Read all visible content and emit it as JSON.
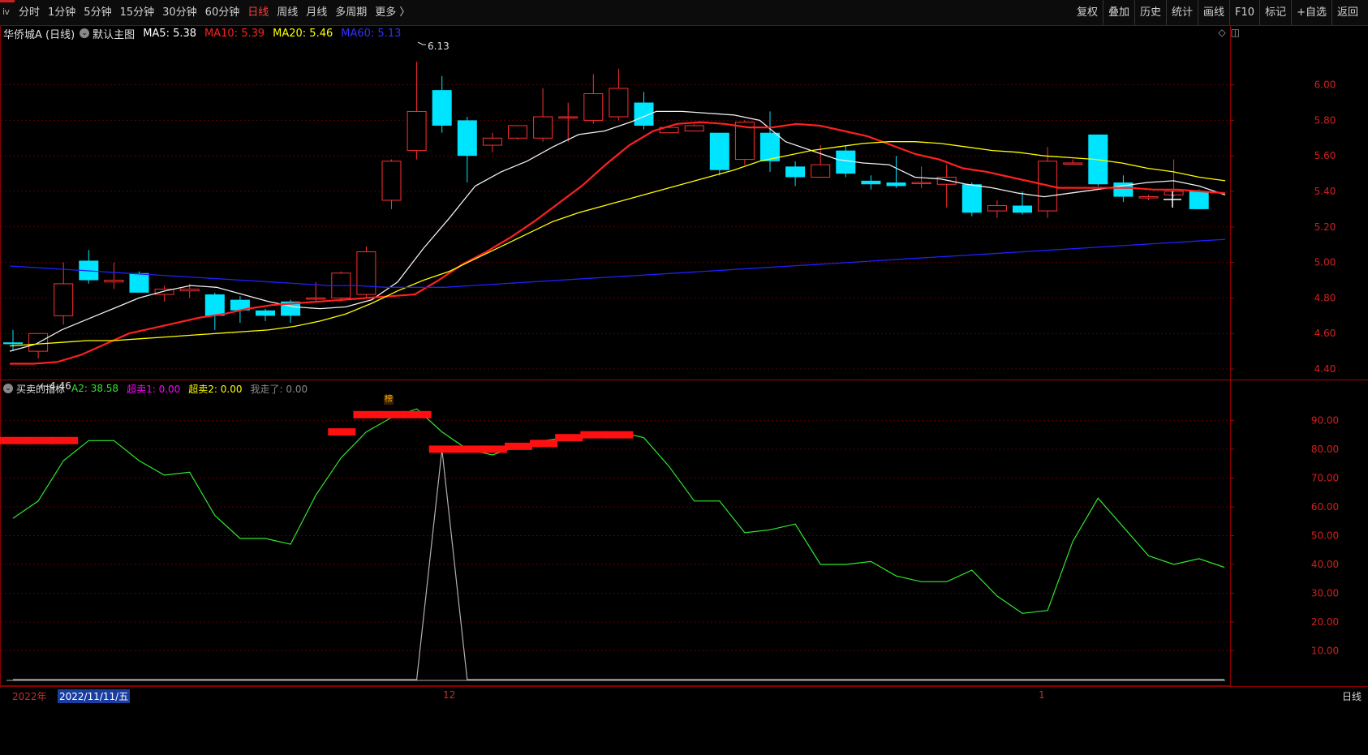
{
  "topbar": {
    "sys_icon": "ⅳ",
    "periods": [
      "分时",
      "1分钟",
      "5分钟",
      "15分钟",
      "30分钟",
      "60分钟",
      "日线",
      "周线",
      "月线",
      "多周期",
      "更多 〉"
    ],
    "active_period": "日线",
    "tools": [
      "复权",
      "叠加",
      "历史",
      "统计",
      "画线",
      "F10",
      "标记",
      "+自选",
      "返回"
    ]
  },
  "main_panel": {
    "stock_name": "华侨城A (日线)",
    "template": "默认主图",
    "ma": [
      {
        "label": "MA5: 5.38",
        "color": "#ffffff"
      },
      {
        "label": "MA10: 5.39",
        "color": "#ff2020"
      },
      {
        "label": "MA20: 5.46",
        "color": "#ffff00"
      },
      {
        "label": "MA60: 5.13",
        "color": "#2020ff"
      }
    ],
    "high_label": "6.13",
    "low_label": "4.46",
    "bang_tag": "榜",
    "icons": [
      "diamond-icon",
      "window-icon"
    ]
  },
  "indicator_panel": {
    "name": "买卖的指标",
    "values": [
      {
        "label": "A2: 38.58",
        "color": "#2ee82e"
      },
      {
        "label": "超卖1: 0.00",
        "color": "#ff00ff"
      },
      {
        "label": "超卖2: 0.00",
        "color": "#ffff00"
      },
      {
        "label": "我走了: 0.00",
        "color": "#888888"
      }
    ]
  },
  "date_axis": {
    "year": "2022年",
    "cursor_date": "2022/11/11/五",
    "month_12": "12",
    "month_1": "1",
    "period_tag": "日线"
  },
  "chart_data": [
    {
      "type": "candlestick",
      "title": "华侨城A (日线)",
      "yticks": [
        "6.00",
        "5.80",
        "5.60",
        "5.40",
        "5.20",
        "5.00",
        "4.80",
        "4.60",
        "4.40"
      ],
      "ylim": [
        4.35,
        6.24
      ],
      "candles": [
        {
          "o": 4.55,
          "h": 4.62,
          "l": 4.5,
          "c": 4.54
        },
        {
          "o": 4.5,
          "h": 4.6,
          "l": 4.46,
          "c": 4.6
        },
        {
          "o": 4.7,
          "h": 5.0,
          "l": 4.65,
          "c": 4.88
        },
        {
          "o": 5.01,
          "h": 5.07,
          "l": 4.88,
          "c": 4.9
        },
        {
          "o": 4.89,
          "h": 5.0,
          "l": 4.85,
          "c": 4.9
        },
        {
          "o": 4.94,
          "h": 4.95,
          "l": 4.83,
          "c": 4.83
        },
        {
          "o": 4.82,
          "h": 4.87,
          "l": 4.78,
          "c": 4.85
        },
        {
          "o": 4.84,
          "h": 4.88,
          "l": 4.8,
          "c": 4.85
        },
        {
          "o": 4.82,
          "h": 4.83,
          "l": 4.62,
          "c": 4.7
        },
        {
          "o": 4.79,
          "h": 4.81,
          "l": 4.66,
          "c": 4.73
        },
        {
          "o": 4.73,
          "h": 4.74,
          "l": 4.67,
          "c": 4.7
        },
        {
          "o": 4.78,
          "h": 4.79,
          "l": 4.66,
          "c": 4.7
        },
        {
          "o": 4.8,
          "h": 4.89,
          "l": 4.78,
          "c": 4.8
        },
        {
          "o": 4.8,
          "h": 4.95,
          "l": 4.78,
          "c": 4.94
        },
        {
          "o": 4.82,
          "h": 5.09,
          "l": 4.8,
          "c": 5.06
        },
        {
          "o": 5.35,
          "h": 5.58,
          "l": 5.3,
          "c": 5.57
        },
        {
          "o": 5.63,
          "h": 6.13,
          "l": 5.58,
          "c": 5.85
        },
        {
          "o": 5.97,
          "h": 6.05,
          "l": 5.73,
          "c": 5.77
        },
        {
          "o": 5.8,
          "h": 5.82,
          "l": 5.45,
          "c": 5.6
        },
        {
          "o": 5.66,
          "h": 5.73,
          "l": 5.62,
          "c": 5.7
        },
        {
          "o": 5.7,
          "h": 5.77,
          "l": 5.69,
          "c": 5.77
        },
        {
          "o": 5.7,
          "h": 5.98,
          "l": 5.68,
          "c": 5.82
        },
        {
          "o": 5.82,
          "h": 5.9,
          "l": 5.68,
          "c": 5.82
        },
        {
          "o": 5.8,
          "h": 6.06,
          "l": 5.78,
          "c": 5.95
        },
        {
          "o": 5.82,
          "h": 6.09,
          "l": 5.8,
          "c": 5.98
        },
        {
          "o": 5.9,
          "h": 5.96,
          "l": 5.75,
          "c": 5.77
        },
        {
          "o": 5.73,
          "h": 5.76,
          "l": 5.73,
          "c": 5.76
        },
        {
          "o": 5.74,
          "h": 5.78,
          "l": 5.74,
          "c": 5.77
        },
        {
          "o": 5.73,
          "h": 5.73,
          "l": 5.49,
          "c": 5.52
        },
        {
          "o": 5.58,
          "h": 5.8,
          "l": 5.55,
          "c": 5.79
        },
        {
          "o": 5.73,
          "h": 5.85,
          "l": 5.51,
          "c": 5.57
        },
        {
          "o": 5.54,
          "h": 5.57,
          "l": 5.43,
          "c": 5.48
        },
        {
          "o": 5.48,
          "h": 5.66,
          "l": 5.48,
          "c": 5.55
        },
        {
          "o": 5.63,
          "h": 5.66,
          "l": 5.48,
          "c": 5.5
        },
        {
          "o": 5.46,
          "h": 5.49,
          "l": 5.41,
          "c": 5.44
        },
        {
          "o": 5.45,
          "h": 5.6,
          "l": 5.42,
          "c": 5.43
        },
        {
          "o": 5.45,
          "h": 5.54,
          "l": 5.42,
          "c": 5.45
        },
        {
          "o": 5.44,
          "h": 5.55,
          "l": 5.31,
          "c": 5.48
        },
        {
          "o": 5.44,
          "h": 5.45,
          "l": 5.26,
          "c": 5.28
        },
        {
          "o": 5.29,
          "h": 5.35,
          "l": 5.25,
          "c": 5.32
        },
        {
          "o": 5.32,
          "h": 5.4,
          "l": 5.27,
          "c": 5.28
        },
        {
          "o": 5.29,
          "h": 5.65,
          "l": 5.25,
          "c": 5.57
        },
        {
          "o": 5.56,
          "h": 5.58,
          "l": 5.55,
          "c": 5.56
        },
        {
          "o": 5.72,
          "h": 5.72,
          "l": 5.43,
          "c": 5.44
        },
        {
          "o": 5.45,
          "h": 5.49,
          "l": 5.34,
          "c": 5.37
        },
        {
          "o": 5.37,
          "h": 5.38,
          "l": 5.35,
          "c": 5.37
        },
        {
          "o": 5.38,
          "h": 5.58,
          "l": 5.37,
          "c": 5.4
        },
        {
          "o": 5.4,
          "h": 5.41,
          "l": 5.3,
          "c": 5.3
        }
      ],
      "series": [
        {
          "name": "MA5",
          "color": "#f0f0f0",
          "values": [
            4.5,
            4.54,
            4.62,
            4.68,
            4.74,
            4.8,
            4.84,
            4.87,
            4.86,
            4.82,
            4.78,
            4.75,
            4.74,
            4.75,
            4.79,
            4.89,
            5.08,
            5.25,
            5.43,
            5.51,
            5.57,
            5.65,
            5.72,
            5.74,
            5.79,
            5.85,
            5.85,
            5.84,
            5.83,
            5.8,
            5.68,
            5.63,
            5.58,
            5.56,
            5.55,
            5.48,
            5.47,
            5.44,
            5.42,
            5.39,
            5.37,
            5.39,
            5.41,
            5.43,
            5.45,
            5.46,
            5.43,
            5.38
          ]
        },
        {
          "name": "MA10",
          "color": "#ff2020",
          "values": [
            4.43,
            4.43,
            4.44,
            4.48,
            4.54,
            4.6,
            4.63,
            4.66,
            4.69,
            4.71,
            4.74,
            4.76,
            4.77,
            4.78,
            4.79,
            4.8,
            4.81,
            4.82,
            4.9,
            4.99,
            5.06,
            5.14,
            5.23,
            5.33,
            5.43,
            5.55,
            5.66,
            5.74,
            5.78,
            5.79,
            5.78,
            5.76,
            5.76,
            5.78,
            5.77,
            5.74,
            5.71,
            5.66,
            5.61,
            5.58,
            5.53,
            5.51,
            5.48,
            5.45,
            5.42,
            5.42,
            5.42,
            5.42,
            5.41,
            5.41,
            5.4,
            5.39
          ]
        },
        {
          "name": "MA20",
          "color": "#ffff00",
          "values": [
            4.53,
            4.54,
            4.55,
            4.56,
            4.56,
            4.57,
            4.58,
            4.59,
            4.6,
            4.61,
            4.62,
            4.64,
            4.67,
            4.71,
            4.77,
            4.84,
            4.9,
            4.95,
            5.02,
            5.09,
            5.16,
            5.23,
            5.28,
            5.32,
            5.36,
            5.4,
            5.44,
            5.48,
            5.52,
            5.57,
            5.6,
            5.63,
            5.65,
            5.67,
            5.68,
            5.68,
            5.67,
            5.65,
            5.63,
            5.62,
            5.6,
            5.59,
            5.58,
            5.56,
            5.53,
            5.51,
            5.48,
            5.46
          ]
        },
        {
          "name": "MA60",
          "color": "#2020ff",
          "values": [
            4.98,
            4.97,
            4.96,
            4.95,
            4.94,
            4.93,
            4.92,
            4.91,
            4.9,
            4.89,
            4.88,
            4.87,
            4.87,
            4.86,
            4.86,
            4.86,
            4.87,
            4.88,
            4.89,
            4.9,
            4.91,
            4.92,
            4.93,
            4.94,
            4.95,
            4.96,
            4.97,
            4.98,
            4.99,
            5.0,
            5.01,
            5.02,
            5.03,
            5.04,
            5.05,
            5.06,
            5.07,
            5.08,
            5.09,
            5.1,
            5.11,
            5.12,
            5.13
          ]
        }
      ]
    },
    {
      "type": "line",
      "title": "买卖的指标",
      "yticks": [
        "90.00",
        "80.00",
        "70.00",
        "60.00",
        "50.00",
        "40.00",
        "30.00",
        "20.00",
        "10.00"
      ],
      "ylim": [
        0,
        98
      ],
      "series": [
        {
          "name": "A2",
          "color": "#2ee82e",
          "values": [
            56,
            62,
            76,
            83,
            83,
            76,
            71,
            72,
            57,
            49,
            49,
            47,
            64,
            77,
            86,
            91,
            94,
            86,
            80,
            78,
            81,
            83,
            84,
            86,
            86,
            84,
            74,
            62,
            62,
            51,
            52,
            54,
            40,
            40,
            41,
            36,
            34,
            34,
            38,
            29,
            23,
            24,
            48,
            63,
            53,
            43,
            40,
            42,
            39
          ]
        },
        {
          "name": "我走了",
          "color": "#b0b0b0",
          "values": [
            0,
            0,
            0,
            0,
            0,
            0,
            0,
            0,
            0,
            0,
            0,
            0,
            0,
            0,
            0,
            0,
            0,
            80,
            0,
            0,
            0,
            0,
            0,
            0,
            0,
            0,
            0,
            0,
            0,
            0,
            0,
            0,
            0,
            0,
            0,
            0,
            0,
            0,
            0,
            0,
            0,
            0,
            0,
            0,
            0,
            0,
            0,
            0,
            0
          ]
        }
      ],
      "signal_bars": [
        83,
        83,
        83,
        0,
        0,
        0,
        0,
        0,
        0,
        0,
        0,
        0,
        0,
        86,
        92,
        92,
        92,
        80,
        80,
        80,
        81,
        82,
        84,
        85,
        85,
        0,
        0,
        0,
        0,
        0,
        0,
        0,
        0,
        0,
        0,
        0,
        0,
        0,
        0,
        0,
        0,
        0,
        0,
        0,
        0,
        0,
        0,
        0,
        0
      ]
    }
  ]
}
